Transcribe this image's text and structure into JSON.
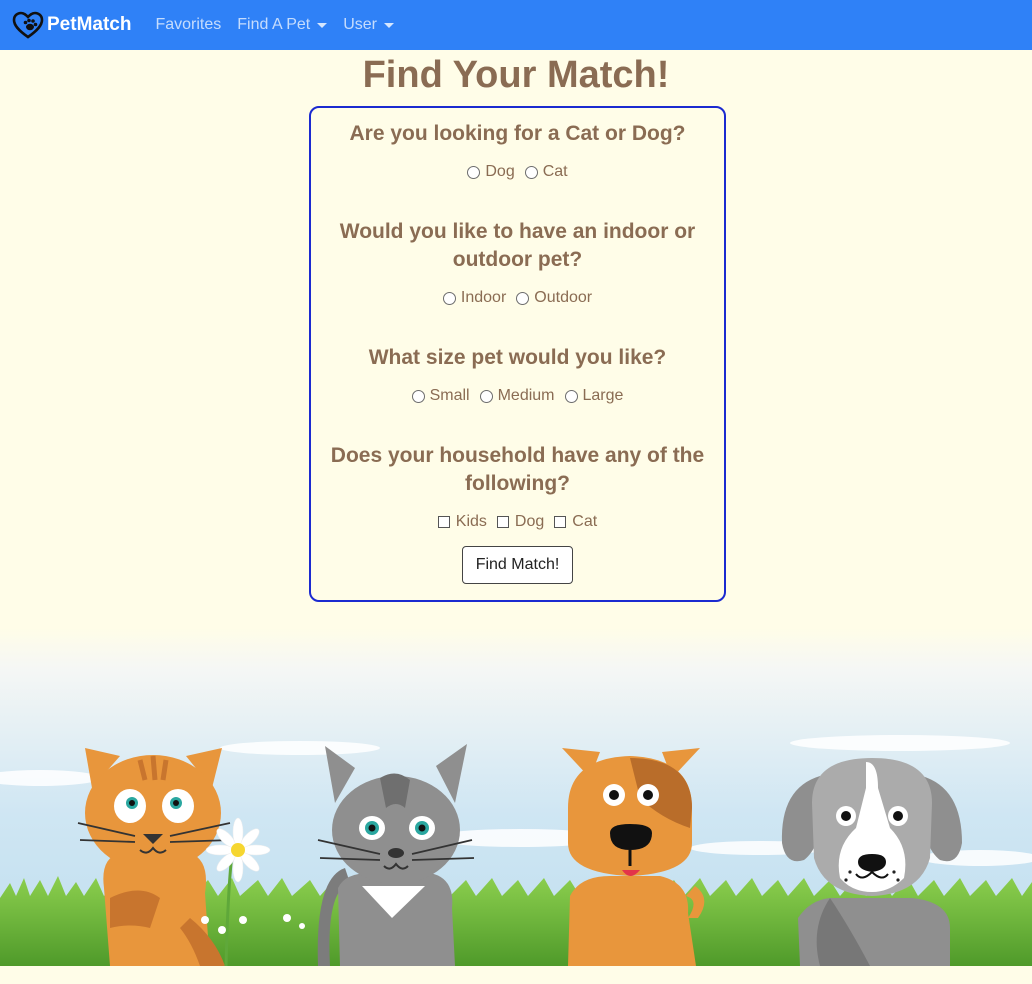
{
  "navbar": {
    "brand": "PetMatch",
    "links": [
      {
        "label": "Favorites"
      },
      {
        "label": "Find A Pet"
      },
      {
        "label": "User"
      }
    ]
  },
  "page": {
    "title": "Find Your Match!"
  },
  "form": {
    "q_type": {
      "label": "Are you looking for a Cat or Dog?",
      "options": [
        "Dog",
        "Cat"
      ]
    },
    "q_indoor": {
      "label": "Would you like to have an indoor or outdoor pet?",
      "line1": "Would you like to have an indoor or",
      "line2": "outdoor pet?",
      "options": [
        "Indoor",
        "Outdoor"
      ]
    },
    "q_size": {
      "label": "What size pet would you like?",
      "options": [
        "Small",
        "Medium",
        "Large"
      ]
    },
    "q_household": {
      "label": "Does your household have any of the following?",
      "line1": "Does your household have any of the",
      "line2": "following?",
      "options": [
        "Kids",
        "Dog",
        "Cat"
      ]
    },
    "submit_label": "Find Match!"
  },
  "colors": {
    "navbar": "#2f81f7",
    "text": "#8a6c53",
    "card_border": "#1b2ad0",
    "background": "#fffde8"
  }
}
